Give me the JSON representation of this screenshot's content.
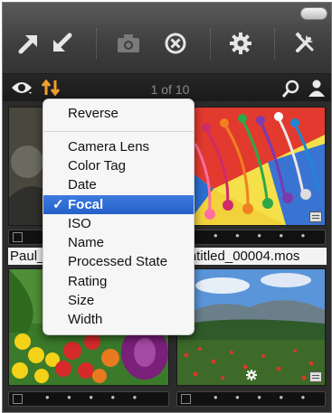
{
  "toolbar": {
    "icons": [
      "arrow-up-right-icon",
      "arrow-down-left-icon",
      "camera-icon",
      "circle-x-icon",
      "gear-icon",
      "tools-icon"
    ]
  },
  "viewer": {
    "counter": "1 of 10"
  },
  "browser": {
    "thumbnails": [
      {
        "filename": "Paul_"
      },
      {
        "filename": "Untitled_00004.mos"
      }
    ],
    "strip_dots": "• • • • •"
  },
  "sort_menu": {
    "items": [
      {
        "label": "Reverse",
        "selected": false
      },
      {
        "label": "Camera Lens",
        "selected": false
      },
      {
        "label": "Color Tag",
        "selected": false
      },
      {
        "label": "Date",
        "selected": false
      },
      {
        "label": "Focal",
        "selected": true,
        "check": "✓"
      },
      {
        "label": "ISO",
        "selected": false
      },
      {
        "label": "Name",
        "selected": false
      },
      {
        "label": "Processed State",
        "selected": false
      },
      {
        "label": "Rating",
        "selected": false
      },
      {
        "label": "Size",
        "selected": false
      },
      {
        "label": "Width",
        "selected": false
      }
    ]
  },
  "colors": {
    "accent_sort": "#f0a030",
    "menu_highlight": "#2f6fd6",
    "toolbar": "#464646"
  }
}
